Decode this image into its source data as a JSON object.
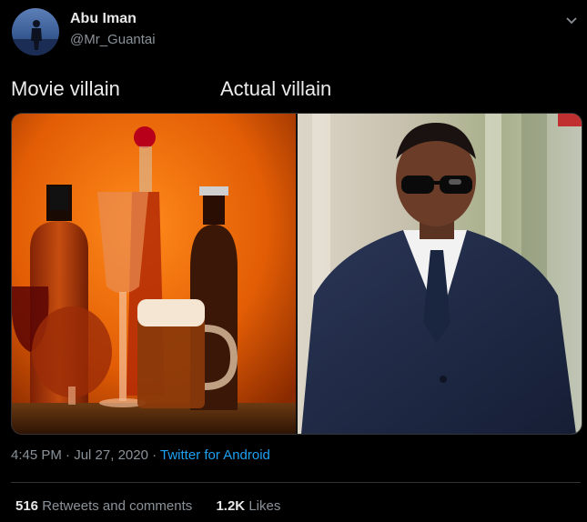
{
  "author": {
    "name": "Abu Iman",
    "handle": "@Mr_Guantai"
  },
  "tweet": {
    "left_text": "Movie villain",
    "right_text": "Actual villain"
  },
  "meta": {
    "time": "4:45 PM",
    "separator1": " · ",
    "date": "Jul 27, 2020",
    "separator2": " · ",
    "source": "Twitter for Android"
  },
  "stats": {
    "retweets_count": "516",
    "retweets_label": "Retweets and comments",
    "likes_count": "1.2K",
    "likes_label": "Likes"
  },
  "colors": {
    "accent": "#1da1f2",
    "background": "#000000"
  }
}
